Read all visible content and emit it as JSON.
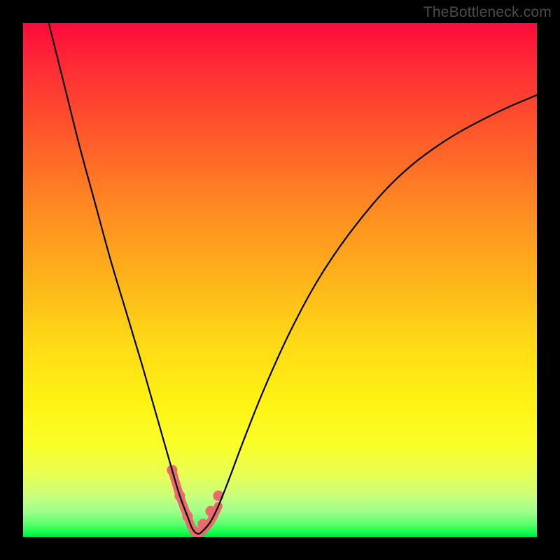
{
  "watermark": "TheBottleneck.com",
  "colors": {
    "frame": "#000000",
    "curve": "#000000",
    "highlight": "#e96a6a"
  },
  "chart_data": {
    "type": "line",
    "title": "",
    "xlabel": "",
    "ylabel": "",
    "xlim": [
      0,
      100
    ],
    "ylim": [
      0,
      100
    ],
    "grid": false,
    "legend": false,
    "series": [
      {
        "name": "curve",
        "x": [
          5,
          8,
          11,
          14,
          17,
          20,
          23,
          25,
          27,
          29,
          30.5,
          32,
          33,
          34,
          35,
          36.5,
          38,
          40,
          43,
          47,
          52,
          58,
          65,
          73,
          82,
          92,
          100
        ],
        "y": [
          100,
          88,
          76,
          65,
          54,
          44,
          34,
          27,
          20,
          13,
          8,
          4,
          1.5,
          0.6,
          1.2,
          3,
          6,
          11,
          19,
          29,
          40,
          51,
          61,
          70,
          77,
          82.5,
          86
        ]
      }
    ],
    "highlight_segment": {
      "note": "pink U-shaped overlay at trough",
      "x": [
        29,
        30.5,
        32,
        33,
        34,
        35,
        36.5,
        38
      ],
      "y": [
        13,
        8,
        4,
        1.5,
        0.6,
        1.2,
        3,
        6
      ],
      "dots_x": [
        29,
        30.5,
        32,
        33.5,
        35,
        36.5,
        38
      ],
      "dots_y": [
        13,
        8,
        4,
        1,
        2.5,
        5,
        8
      ]
    }
  }
}
